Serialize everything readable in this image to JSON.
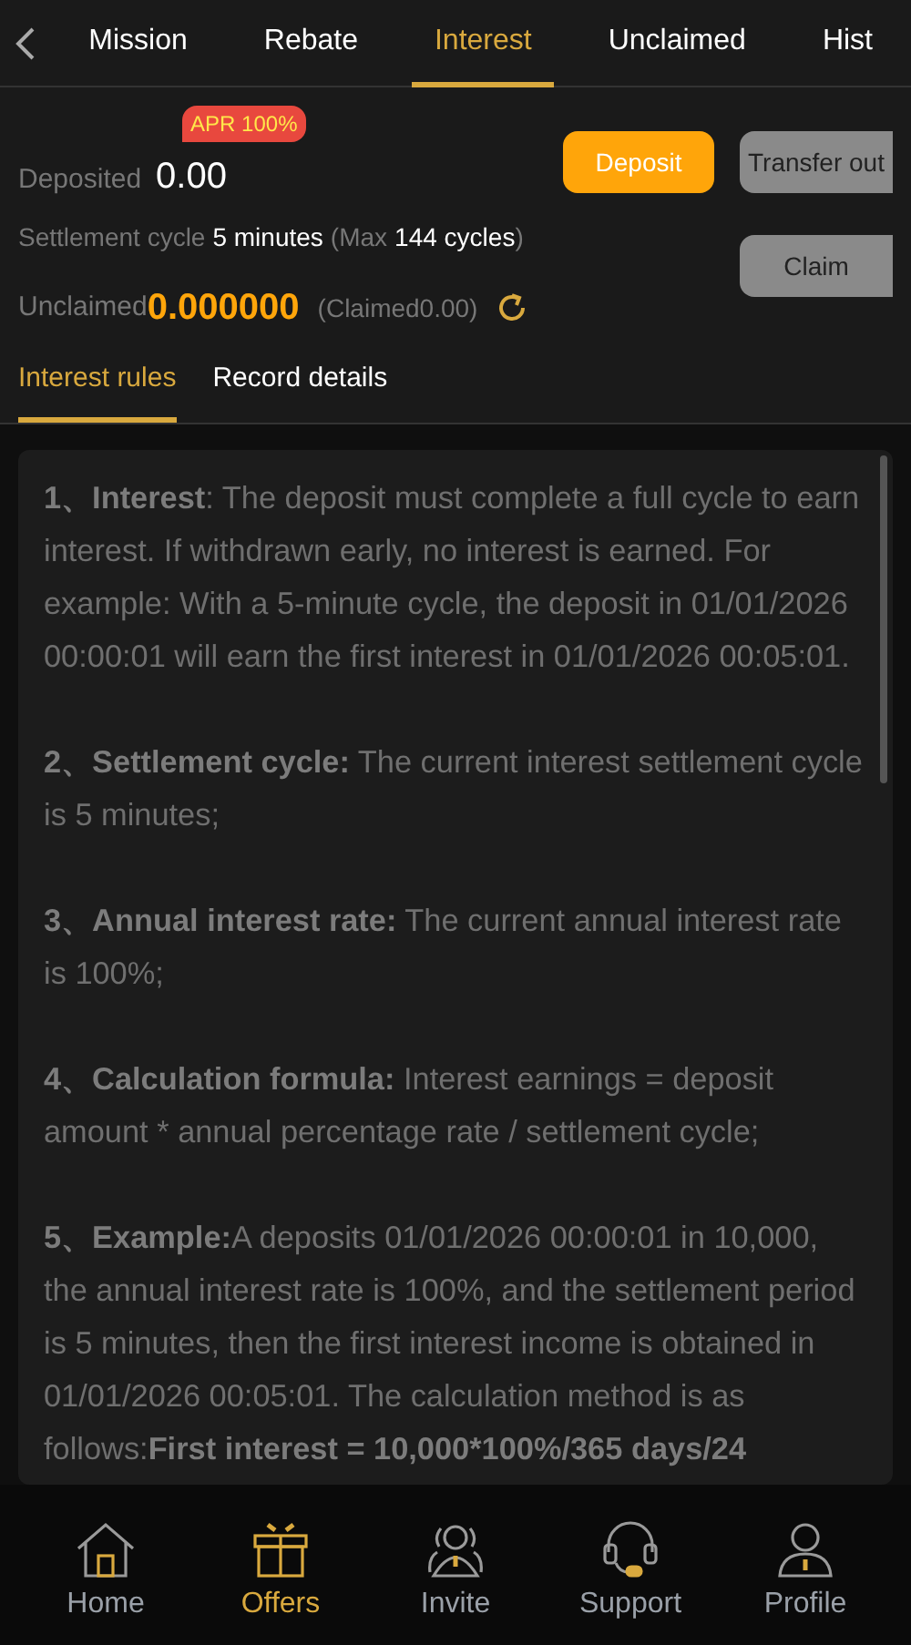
{
  "top_tabs": [
    {
      "label": "Mission",
      "selected": false
    },
    {
      "label": "Rebate",
      "selected": false
    },
    {
      "label": "Interest",
      "selected": true
    },
    {
      "label": "Unclaimed",
      "selected": false
    },
    {
      "label": "Hist",
      "selected": false
    }
  ],
  "summary": {
    "badge": "APR 100%",
    "deposited_label": "Deposited",
    "deposited_value": "0.00",
    "cycle_label": "Settlement cycle",
    "cycle_value": "5 minutes",
    "max_open": "(Max",
    "max_value": "144 cycles",
    "max_close": ")",
    "unclaimed_label": "Unclaimed",
    "unclaimed_value": "0.000000",
    "claimed": "(Claimed0.00)"
  },
  "buttons": [
    {
      "label": "Deposit",
      "kind": "primary"
    },
    {
      "label": "Transfer out",
      "kind": "secondary"
    },
    {
      "label": "Claim",
      "kind": "secondary"
    }
  ],
  "sub_tabs": [
    {
      "label": "Interest rules",
      "selected": true
    },
    {
      "label": "Record details",
      "selected": false
    }
  ],
  "rules": [
    [
      {
        "text": "1、Interest",
        "strong": true
      },
      {
        "text": ": The deposit must complete a full cycle to earn interest. If withdrawn early, no interest is earned. For example: With a 5-minute cycle, the deposit in 01/01/2026 00:00:01 will earn the first interest in 01/01/2026 00:05:01.",
        "strong": false
      }
    ],
    [
      {
        "text": "2、Settlement cycle:",
        "strong": true
      },
      {
        "text": " The current interest settlement cycle is 5 minutes;",
        "strong": false
      }
    ],
    [
      {
        "text": "3、Annual interest rate:",
        "strong": true
      },
      {
        "text": " The current annual interest rate is 100%;",
        "strong": false
      }
    ],
    [
      {
        "text": "4、Calculation formula:",
        "strong": true
      },
      {
        "text": " Interest earnings = deposit amount * annual percentage rate / settlement cycle;",
        "strong": false
      }
    ],
    [
      {
        "text": "5、Example:",
        "strong": true
      },
      {
        "text": "A deposits 01/01/2026 00:00:01 in 10,000, the annual interest rate is 100%, and the settlement period is 5 minutes, then the first interest income is obtained in 01/01/2026 00:05:01. The calculation method is as follows:",
        "strong": false
      },
      {
        "text": "First interest = 10,000*100%/365 days/24",
        "strong": true
      }
    ]
  ],
  "bottom_nav": [
    {
      "label": "Home",
      "selected": false
    },
    {
      "label": "Offers",
      "selected": true
    },
    {
      "label": "Invite",
      "selected": false
    },
    {
      "label": "Support",
      "selected": false
    },
    {
      "label": "Profile",
      "selected": false
    }
  ]
}
